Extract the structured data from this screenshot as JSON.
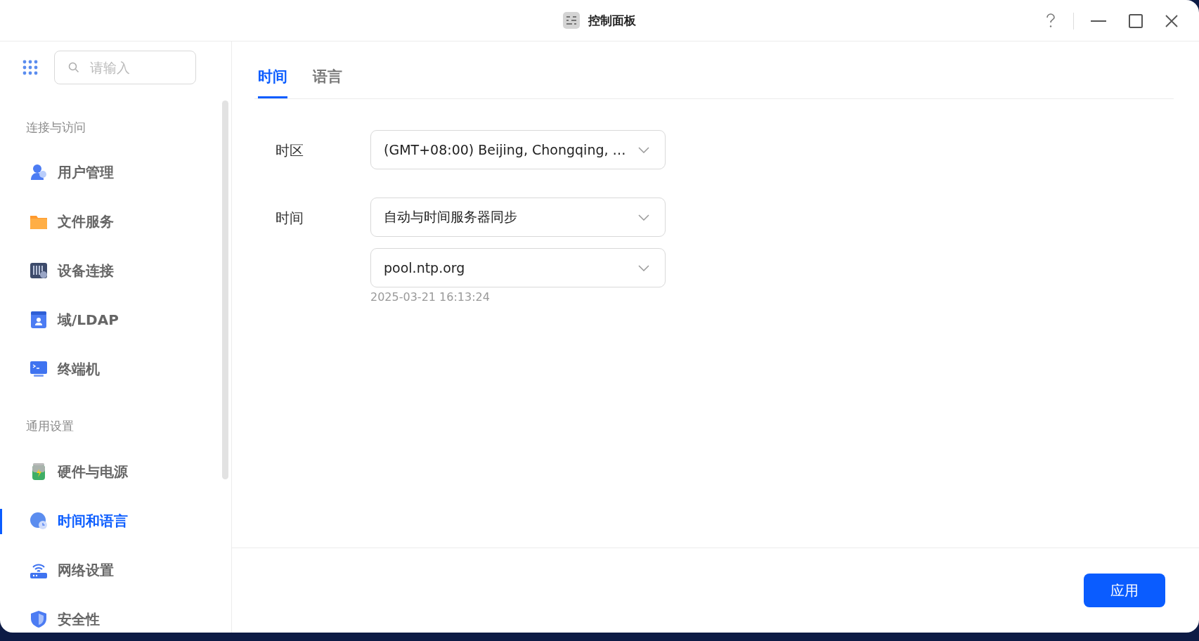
{
  "window": {
    "title": "控制面板"
  },
  "sidebar": {
    "search": {
      "placeholder": "请输入"
    },
    "sections": [
      {
        "title": "连接与访问",
        "items": [
          {
            "label": "用户管理",
            "selected": false
          },
          {
            "label": "文件服务",
            "selected": false
          },
          {
            "label": "设备连接",
            "selected": false
          },
          {
            "label": "域/LDAP",
            "selected": false
          },
          {
            "label": "终端机",
            "selected": false
          }
        ]
      },
      {
        "title": "通用设置",
        "items": [
          {
            "label": "硬件与电源",
            "selected": false
          },
          {
            "label": "时间和语言",
            "selected": true
          },
          {
            "label": "网络设置",
            "selected": false
          },
          {
            "label": "安全性",
            "selected": false
          }
        ]
      }
    ]
  },
  "tabs": [
    {
      "label": "时间",
      "selected": true
    },
    {
      "label": "语言",
      "selected": false
    }
  ],
  "form": [
    {
      "label": "时区",
      "selects": [
        {
          "value": "(GMT+08:00) Beijing, Chongqing, …"
        }
      ]
    },
    {
      "label": "时间",
      "selects": [
        {
          "value": "自动与时间服务器同步"
        },
        {
          "value": "pool.ntp.org"
        }
      ],
      "hint": "2025-03-21 16:13:24"
    }
  ],
  "apply_button": "应用"
}
